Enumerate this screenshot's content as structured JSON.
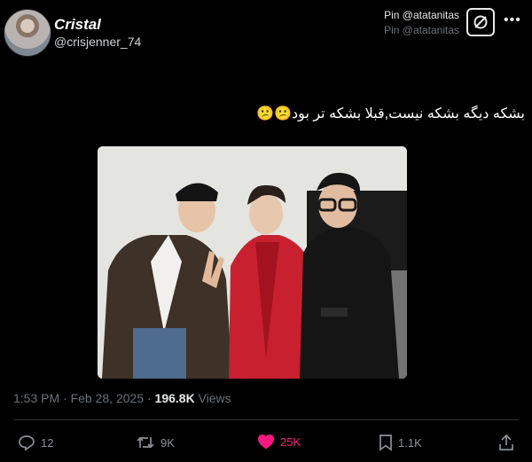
{
  "user": {
    "display_name": "Cristal",
    "handle": "@crisjenner_74"
  },
  "pin": {
    "line1": "Pin @atatanitas",
    "line2": "Pin @atatanitas"
  },
  "tweet": {
    "text": "بشکه دیگه بشکه نیست,قبلا بشکه تر بود😕😕"
  },
  "meta": {
    "time": "1:53 PM · Feb 28, 2025 · ",
    "views_count": "196.8K",
    "views_label": " Views"
  },
  "actions": {
    "replies": "12",
    "reposts": "9K",
    "likes": "25K",
    "bookmarks": "1.1K"
  },
  "colors": {
    "like": "#f91880",
    "muted": "#6b7177"
  }
}
